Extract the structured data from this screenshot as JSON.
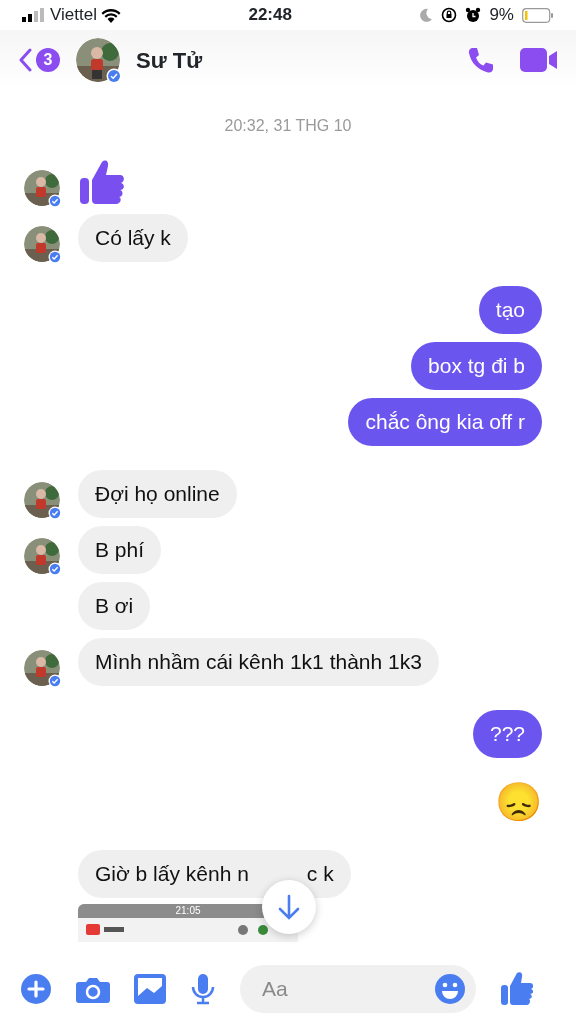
{
  "status_bar": {
    "carrier": "Viettel",
    "time": "22:48",
    "battery": "9%"
  },
  "header": {
    "unread_count": "3",
    "contact_name": "Sư Tử"
  },
  "timestamp": "20:32, 31 THG 10",
  "messages": [
    {
      "kind": "like",
      "sent": false,
      "avatar": true
    },
    {
      "kind": "text",
      "sent": false,
      "avatar": true,
      "text": "Có lấy k"
    },
    {
      "kind": "text",
      "sent": true,
      "text": "tạo"
    },
    {
      "kind": "text",
      "sent": true,
      "text": "box tg đi b"
    },
    {
      "kind": "text",
      "sent": true,
      "text": "chắc ông kia off r"
    },
    {
      "kind": "text",
      "sent": false,
      "avatar": true,
      "text": "Đợi họ online"
    },
    {
      "kind": "text",
      "sent": false,
      "avatar": true,
      "text": "B phí"
    },
    {
      "kind": "text",
      "sent": false,
      "avatar": false,
      "text": "B ơi"
    },
    {
      "kind": "text",
      "sent": false,
      "avatar": true,
      "text": "Mình nhầm cái kênh 1k1 thành 1k3"
    },
    {
      "kind": "text",
      "sent": true,
      "text": "???"
    },
    {
      "kind": "emoji",
      "sent": true,
      "text": "😞"
    },
    {
      "kind": "covered",
      "sent": false,
      "avatar": false,
      "text_before": "Giờ b lấy kênh n",
      "text_after": "c k"
    },
    {
      "kind": "screenshot",
      "sent": false,
      "avatar": false,
      "time": "21:05"
    }
  ],
  "composer": {
    "placeholder": "Aa"
  }
}
